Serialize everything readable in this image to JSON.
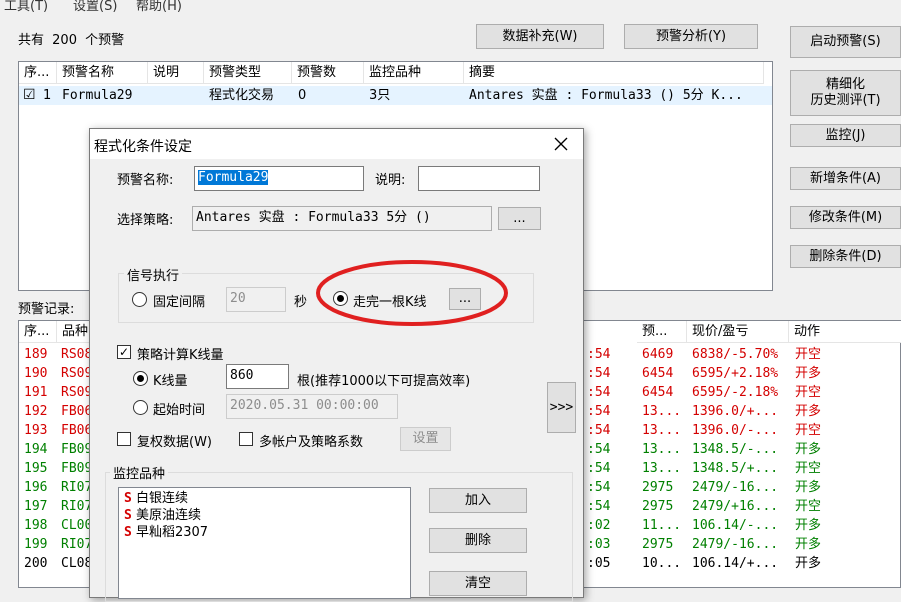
{
  "menu": [
    "工具(T)",
    "设置(S)",
    "帮助(H)"
  ],
  "summary": {
    "prefix": "共有",
    "count": "200",
    "suffix": "个预警"
  },
  "top_buttons": {
    "supplement": "数据补充(W)",
    "analysis": "预警分析(Y)"
  },
  "right_buttons": {
    "start": "启动预警(S)",
    "refine_line1": "精细化",
    "refine_line2": "历史测评(T)",
    "monitor": "监控(J)",
    "add": "新增条件(A)",
    "modify": "修改条件(M)",
    "delete": "删除条件(D)"
  },
  "alert_table": {
    "headers": [
      "序...",
      "预警名称",
      "说明",
      "预警类型",
      "预警数",
      "监控品种",
      "摘要"
    ],
    "rows": [
      {
        "checked": "☑",
        "index": "1",
        "name": "Formula29",
        "desc": "",
        "type": "程式化交易",
        "count": "0",
        "symbols": "3只",
        "summary": "Antares 实盘 : Formula33 () 5分 K..."
      }
    ]
  },
  "records": {
    "label": "预警记录:",
    "headers_left": [
      "序...",
      "品种"
    ],
    "headers_right": [
      "预...",
      "现价/盈亏",
      "动作"
    ],
    "rows": [
      {
        "idx": "189",
        "sym": "RS08",
        "time": ":54",
        "warn": "6469",
        "price": "6838/-5.70%",
        "action": "开空",
        "color": "red"
      },
      {
        "idx": "190",
        "sym": "RS09",
        "time": ":54",
        "warn": "6454",
        "price": "6595/+2.18%",
        "action": "开多",
        "color": "red"
      },
      {
        "idx": "191",
        "sym": "RS09",
        "time": ":54",
        "warn": "6454",
        "price": "6595/-2.18%",
        "action": "开空",
        "color": "red"
      },
      {
        "idx": "192",
        "sym": "FB06",
        "time": ":54",
        "warn": "13...",
        "price": "1396.0/+...",
        "action": "开多",
        "color": "red"
      },
      {
        "idx": "193",
        "sym": "FB06",
        "time": ":54",
        "warn": "13...",
        "price": "1396.0/-...",
        "action": "开空",
        "color": "red"
      },
      {
        "idx": "194",
        "sym": "FB09",
        "time": ":54",
        "warn": "13...",
        "price": "1348.5/-...",
        "action": "开多",
        "color": "green"
      },
      {
        "idx": "195",
        "sym": "FB09",
        "time": ":54",
        "warn": "13...",
        "price": "1348.5/+...",
        "action": "开空",
        "color": "green"
      },
      {
        "idx": "196",
        "sym": "RI07",
        "time": ":54",
        "warn": "2975",
        "price": "2479/-16...",
        "action": "开多",
        "color": "green"
      },
      {
        "idx": "197",
        "sym": "RI07",
        "time": ":54",
        "warn": "2975",
        "price": "2479/+16...",
        "action": "开空",
        "color": "green"
      },
      {
        "idx": "198",
        "sym": "CL00",
        "time": ":02",
        "warn": "11...",
        "price": "106.14/-...",
        "action": "开多",
        "color": "green"
      },
      {
        "idx": "199",
        "sym": "RI07",
        "time": ":03",
        "warn": "2975",
        "price": "2479/-16...",
        "action": "开多",
        "color": "green"
      },
      {
        "idx": "200",
        "sym": "CL08",
        "time": ":05",
        "warn": "10...",
        "price": "106.14/+...",
        "action": "开多",
        "color": "black"
      }
    ]
  },
  "dialog": {
    "title": "程式化条件设定",
    "name_label": "预警名称:",
    "name_value": "Formula29",
    "desc_label": "说明:",
    "desc_value": "",
    "strategy_label": "选择策略:",
    "strategy_value": "Antares 实盘 : Formula33 5分 ()",
    "browse": "...",
    "signal_group": "信号执行",
    "fixed_interval": "固定间隔",
    "interval_value": "20",
    "seconds": "秒",
    "bar_complete": "走完一根K线",
    "bar_more": "...",
    "calc_kline": "策略计算K线量",
    "kline_count_label": "K线量",
    "kline_count_value": "860",
    "kline_hint": "根(推荐1000以下可提高效率)",
    "start_time_label": "起始时间",
    "start_time_value": "2020.05.31 00:00:00",
    "reweight": "复权数据(W)",
    "multi_account": "多帐户及策略系数",
    "settings": "设置",
    "expand": ">>>",
    "monitor_group": "监控品种",
    "monitor_items": [
      {
        "flag": "S",
        "name": "白银连续"
      },
      {
        "flag": "S",
        "name": "美原油连续"
      },
      {
        "flag": "S",
        "name": "早籼稻2307"
      }
    ],
    "join": "加入",
    "remove": "删除",
    "clear": "清空"
  }
}
